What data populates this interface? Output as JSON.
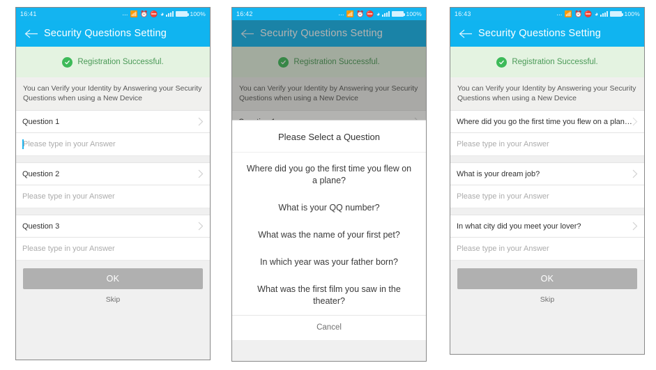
{
  "app": {
    "title": "Security Questions Setting",
    "back_icon": "back-arrow-icon",
    "accent_color": "#10b4f0",
    "success_color": "#3dba59"
  },
  "status_bar": {
    "dots": "...",
    "bluetooth_icon": "bluetooth-icon",
    "alarm_icon": "alarm-icon",
    "dnd_icon": "do-not-disturb-icon",
    "wifi_icon": "wifi-icon",
    "signal_icon": "signal-bars-icon",
    "battery_icon": "battery-icon",
    "battery_level": "100%"
  },
  "banner": {
    "text": "Registration Successful.",
    "icon": "check-circle-icon"
  },
  "hint": "You can Verify your Identity by Answering your Security Questions when using a New Device",
  "placeholder": "Please type in your Answer",
  "buttons": {
    "ok": "OK",
    "skip": "Skip",
    "cancel": "Cancel"
  },
  "panels": [
    {
      "time": "16:41",
      "state": "empty",
      "questions": [
        "Question 1",
        "Question 2",
        "Question 3"
      ],
      "answers": [
        "",
        "",
        ""
      ],
      "focused_index": 0
    },
    {
      "time": "16:42",
      "state": "dialog-open",
      "questions": [
        "Question 1"
      ],
      "dialog": {
        "title": "Please Select a Question",
        "options": [
          "Where did you go the first time you flew on a plane?",
          "What is your QQ number?",
          "What was the name of your first pet?",
          "In which year was your father born?",
          "What was the first film you saw in the theater?"
        ],
        "cancel": "Cancel"
      }
    },
    {
      "time": "16:43",
      "state": "selected",
      "questions": [
        "Where did you go the first time you flew on a plane?",
        "What is your dream job?",
        "In what city did you meet your lover?"
      ],
      "answers": [
        "",
        "",
        ""
      ]
    }
  ]
}
